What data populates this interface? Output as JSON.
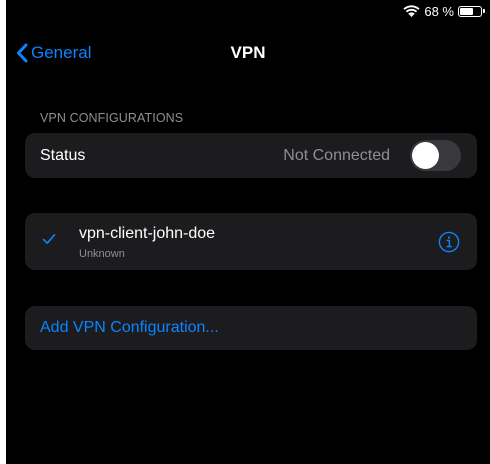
{
  "status_bar": {
    "wifi_icon": "wifi-icon",
    "battery_percent": "68 %",
    "battery_level": 0.68,
    "battery_icon": "battery-icon"
  },
  "nav": {
    "back_icon": "chevron-left-icon",
    "back_label": "General",
    "title": "VPN"
  },
  "vpn_configurations": {
    "header": "VPN CONFIGURATIONS",
    "status_label": "Status",
    "status_value": "Not Connected",
    "status_toggle_on": false,
    "configs": [
      {
        "name": "vpn-client-john-doe",
        "subtitle": "Unknown",
        "selected": true,
        "check_icon": "checkmark-icon",
        "info_icon": "info-icon"
      }
    ],
    "add_label": "Add VPN Configuration..."
  },
  "colors": {
    "background": "#000000",
    "cell": "#1c1c1e",
    "accent": "#0a84ff",
    "secondary_text": "#8e8e93",
    "toggle_off": "#39393d"
  }
}
